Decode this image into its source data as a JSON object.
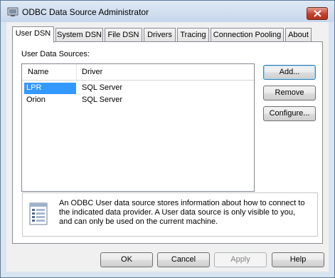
{
  "window": {
    "title": "ODBC Data Source Administrator"
  },
  "tabs": [
    {
      "label": "User DSN"
    },
    {
      "label": "System DSN"
    },
    {
      "label": "File DSN"
    },
    {
      "label": "Drivers"
    },
    {
      "label": "Tracing"
    },
    {
      "label": "Connection Pooling"
    },
    {
      "label": "About"
    }
  ],
  "user_dsn": {
    "section_label": "User Data Sources:",
    "columns": [
      "Name",
      "Driver"
    ],
    "rows": [
      {
        "name": "LPR",
        "driver": "SQL Server",
        "selected": true
      },
      {
        "name": "Orion",
        "driver": "SQL Server",
        "selected": false
      }
    ],
    "buttons": {
      "add": "Add...",
      "remove": "Remove",
      "configure": "Configure..."
    },
    "info": {
      "lines": [
        "An ODBC User data source stores information about how to connect to",
        "the indicated data provider.   A User data source is only visible to you,",
        "and can only be used on the current machine."
      ]
    }
  },
  "footer": {
    "ok": "OK",
    "cancel": "Cancel",
    "apply": "Apply",
    "help": "Help"
  },
  "colors": {
    "selection": "#3399ff",
    "window_frame": "#d9e4f1",
    "close_button": "#c4412c"
  }
}
